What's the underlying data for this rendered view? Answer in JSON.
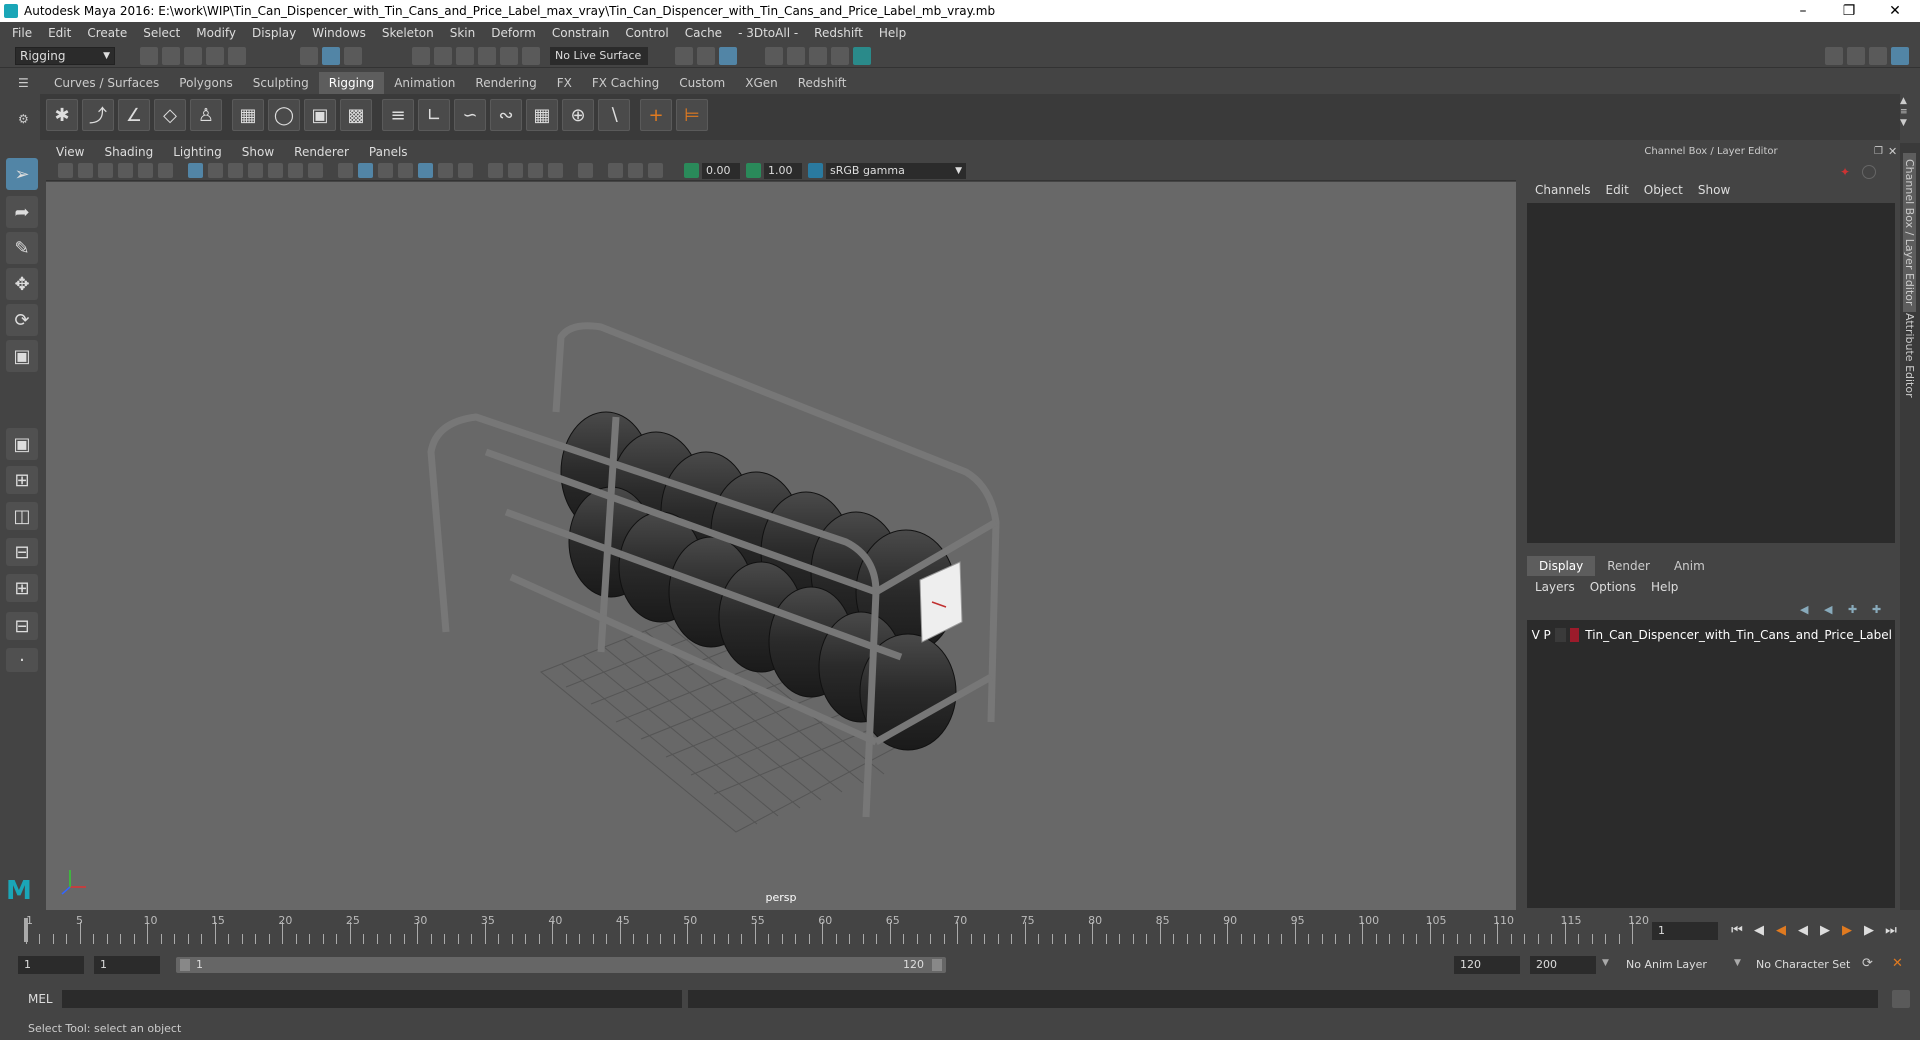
{
  "title": "Autodesk Maya 2016: E:\\work\\WIP\\Tin_Can_Dispencer_with_Tin_Cans_and_Price_Label_max_vray\\Tin_Can_Dispencer_with_Tin_Cans_and_Price_Label_mb_vray.mb",
  "menus": [
    "File",
    "Edit",
    "Create",
    "Select",
    "Modify",
    "Display",
    "Windows",
    "Skeleton",
    "Skin",
    "Deform",
    "Constrain",
    "Control",
    "Cache",
    "- 3DtoAll -",
    "Redshift",
    "Help"
  ],
  "mode": "Rigging",
  "live_surface": "No Live Surface",
  "shelf_tabs": [
    "Curves / Surfaces",
    "Polygons",
    "Sculpting",
    "Rigging",
    "Animation",
    "Rendering",
    "FX",
    "FX Caching",
    "Custom",
    "XGen",
    "Redshift"
  ],
  "active_shelf": "Rigging",
  "panel_menus": [
    "View",
    "Shading",
    "Lighting",
    "Show",
    "Renderer",
    "Panels"
  ],
  "viewport": {
    "exposure": "0.00",
    "gamma": "1.00",
    "color_space": "sRGB gamma",
    "camera": "persp"
  },
  "channel_box": {
    "title": "Channel Box / Layer Editor",
    "menus": [
      "Channels",
      "Edit",
      "Object",
      "Show"
    ]
  },
  "layer_editor": {
    "tabs": [
      "Display",
      "Render",
      "Anim"
    ],
    "active_tab": "Display",
    "menus": [
      "Layers",
      "Options",
      "Help"
    ],
    "layer": {
      "v": "V",
      "p": "P",
      "name": "Tin_Can_Dispencer_with_Tin_Cans_and_Price_Label",
      "color": "#9c1b2b"
    }
  },
  "side_tabs": [
    "Channel Box / Layer Editor",
    "Attribute Editor"
  ],
  "timeline": {
    "ticks": [
      "5",
      "10",
      "15",
      "20",
      "25",
      "30",
      "35",
      "40",
      "45",
      "50",
      "55",
      "60",
      "65",
      "70",
      "75",
      "80",
      "85",
      "90",
      "95",
      "100",
      "105",
      "110",
      "115",
      "120"
    ],
    "start_label": "1",
    "current_frame": "1"
  },
  "range": {
    "start": "1",
    "anim_start": "1",
    "slider_start": "1",
    "slider_end": "120",
    "anim_end": "120",
    "end": "200",
    "anim_layer": "No Anim Layer",
    "character_set": "No Character Set"
  },
  "command": {
    "label": "MEL"
  },
  "help_line": "Select Tool: select an object"
}
